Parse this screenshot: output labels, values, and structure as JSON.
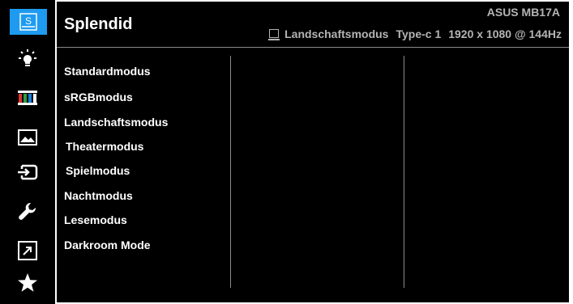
{
  "header": {
    "title": "Splendid",
    "model": "ASUS MB17A",
    "status": {
      "mode": "Landschaftsmodus",
      "input": "Type-c 1",
      "resolution": "1920 x 1080 @ 144Hz"
    }
  },
  "sidebar": {
    "items": [
      {
        "icon": "splendid-icon",
        "label": "S",
        "active": true
      },
      {
        "icon": "brightness-icon"
      },
      {
        "icon": "color-bars-icon"
      },
      {
        "icon": "image-icon"
      },
      {
        "icon": "input-select-icon"
      },
      {
        "icon": "wrench-icon"
      },
      {
        "icon": "shortcut-icon"
      },
      {
        "icon": "favorite-star-icon"
      }
    ]
  },
  "menu": {
    "items": [
      "Standardmodus",
      "sRGBmodus",
      "Landschaftsmodus",
      "Theatermodus",
      "Spielmodus",
      "Nachtmodus",
      "Lesemodus",
      "Darkroom Mode"
    ]
  },
  "colors": {
    "background": "#000000",
    "accent": "#1e9bf0",
    "text": "#ffffff",
    "muted": "#b4b4b4",
    "divider": "#8a8a8a"
  }
}
